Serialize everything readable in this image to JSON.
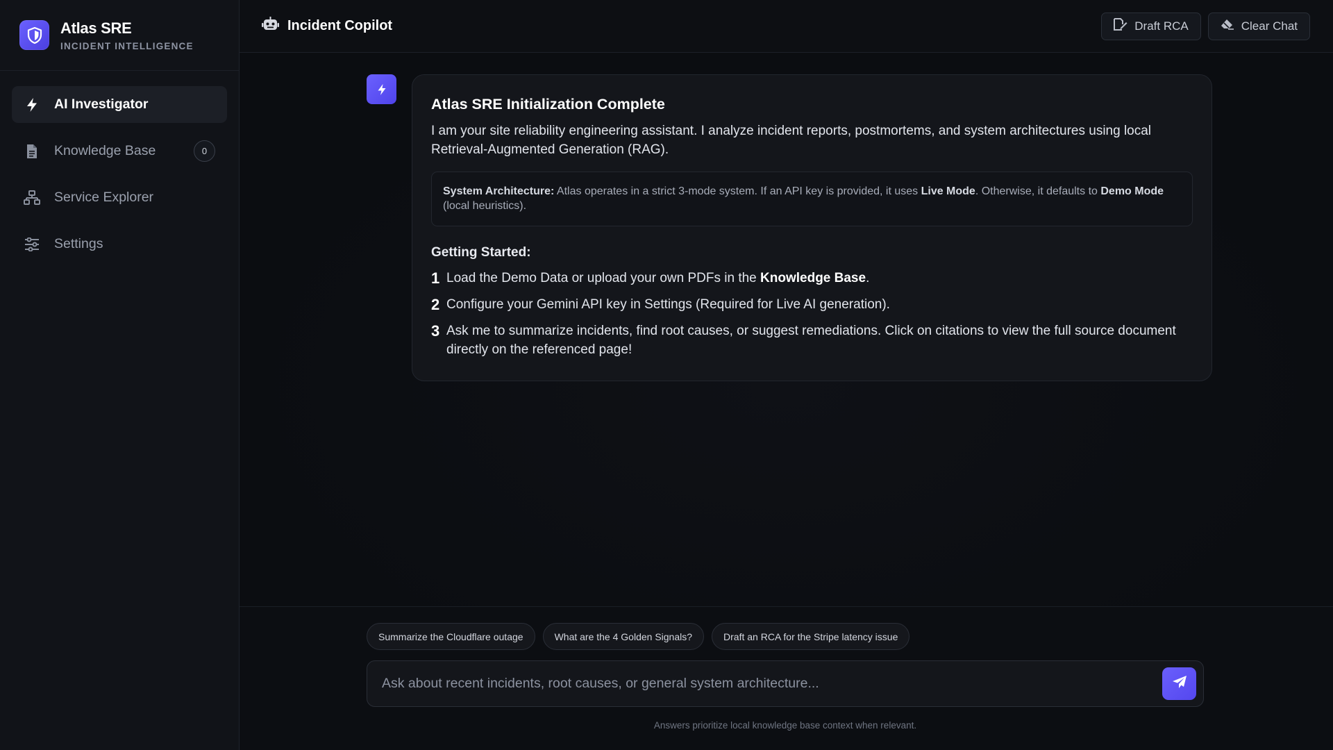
{
  "brand": {
    "name": "Atlas SRE",
    "subtitle": "INCIDENT INTELLIGENCE",
    "logo_icon": "shield-icon"
  },
  "sidebar": {
    "items": [
      {
        "label": "AI Investigator",
        "icon": "bolt-icon",
        "active": true
      },
      {
        "label": "Knowledge Base",
        "icon": "document-icon",
        "badge": "0"
      },
      {
        "label": "Service Explorer",
        "icon": "network-icon"
      },
      {
        "label": "Settings",
        "icon": "sliders-icon"
      }
    ]
  },
  "header": {
    "title": "Incident Copilot",
    "title_icon": "robot-icon",
    "draft_rca_label": "Draft RCA",
    "clear_chat_label": "Clear Chat"
  },
  "message": {
    "avatar_icon": "bolt-icon",
    "title": "Atlas SRE Initialization Complete",
    "intro": "I am your site reliability engineering assistant. I analyze incident reports, postmortems, and system architectures using local Retrieval-Augmented Generation (RAG).",
    "arch": {
      "label": "System Architecture:",
      "text1": " Atlas operates in a strict 3-mode system. If an API key is provided, it uses ",
      "live": "Live Mode",
      "text2": ". Otherwise, it defaults to ",
      "demo": "Demo Mode",
      "text3": " (local heuristics)."
    },
    "getting_started": "Getting Started:",
    "steps": [
      {
        "num": "1",
        "pre": "Load the Demo Data or upload your own PDFs in the ",
        "bold": "Knowledge Base",
        "post": "."
      },
      {
        "num": "2",
        "text": "Configure your Gemini API key in Settings (Required for Live AI generation)."
      },
      {
        "num": "3",
        "text": "Ask me to summarize incidents, find root causes, or suggest remediations. Click on citations to view the full source document directly on the referenced page!"
      }
    ]
  },
  "composer": {
    "suggestions": [
      "Summarize the Cloudflare outage",
      "What are the 4 Golden Signals?",
      "Draft an RCA for the Stripe latency issue"
    ],
    "placeholder": "Ask about recent incidents, root causes, or general system architecture...",
    "value": "",
    "send_icon": "send-icon",
    "footnote": "Answers prioritize local knowledge base context when relevant."
  },
  "colors": {
    "accent": "#5b50f5",
    "background": "#0b0d11",
    "sidebar": "#111318",
    "card": "#14161b"
  }
}
